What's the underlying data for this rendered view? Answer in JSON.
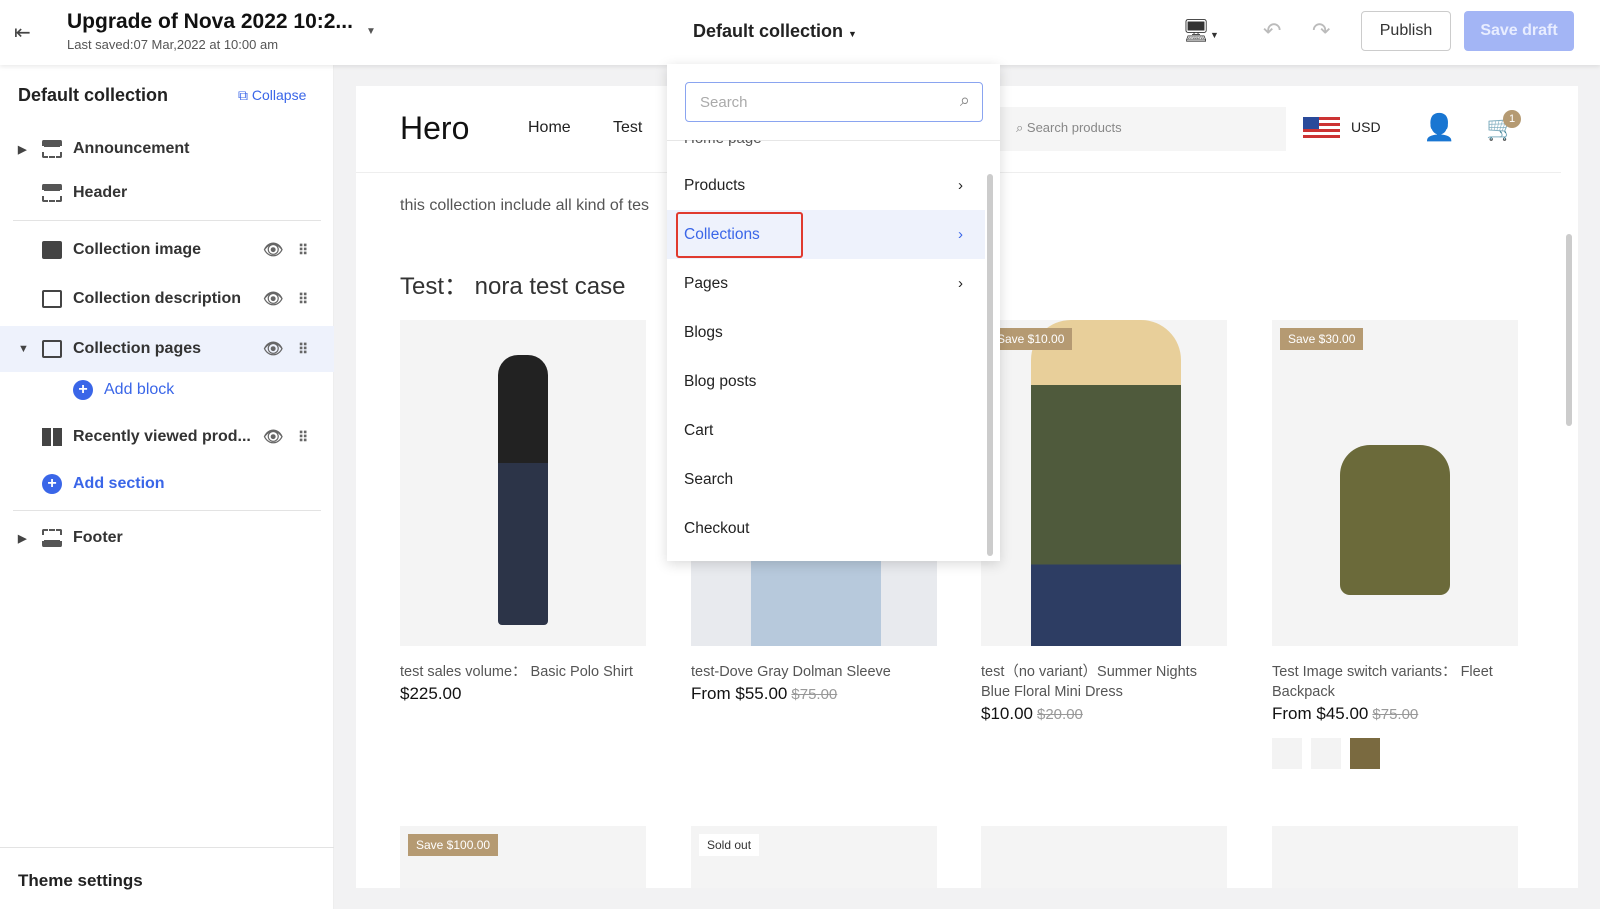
{
  "topbar": {
    "title": "Upgrade of Nova 2022 10:2...",
    "last_saved": "Last saved:07 Mar,2022 at 10:00 am",
    "collection_selector": "Default collection",
    "publish": "Publish",
    "save_draft": "Save draft"
  },
  "sidebar": {
    "title": "Default collection",
    "collapse": "Collapse",
    "items": [
      {
        "label": "Announcement"
      },
      {
        "label": "Header"
      },
      {
        "label": "Collection image"
      },
      {
        "label": "Collection description"
      },
      {
        "label": "Collection pages"
      },
      {
        "label": "Add block"
      },
      {
        "label": "Recently viewed prod..."
      },
      {
        "label": "Add section"
      },
      {
        "label": "Footer"
      }
    ],
    "theme_settings": "Theme settings"
  },
  "store": {
    "logo": "Hero",
    "nav": [
      "Home",
      "Test"
    ],
    "search_placeholder": "Search products",
    "currency": "USD",
    "cart_count": "1",
    "description": "this collection include all kind of tes",
    "heading": "Test： nora test case",
    "products": [
      {
        "name": "test sales volume： Basic Polo Shirt",
        "price": "$225.00",
        "old": ""
      },
      {
        "name": "test-Dove Gray Dolman Sleeve",
        "price": "From $55.00",
        "old": "$75.00"
      },
      {
        "name": "test（no variant）Summer Nights Blue Floral Mini Dress",
        "price": "$10.00",
        "old": "$20.00",
        "badge": "Save $10.00"
      },
      {
        "name": "Test Image switch variants： Fleet Backpack",
        "price": "From $45.00",
        "old": "$75.00",
        "badge": "Save $30.00"
      }
    ],
    "row2_badges": [
      "Save $100.00",
      "Sold out"
    ]
  },
  "dropdown": {
    "search_placeholder": "Search",
    "partial_item": "Home page",
    "items": [
      {
        "label": "Products"
      },
      {
        "label": "Collections"
      },
      {
        "label": "Pages"
      },
      {
        "label": "Blogs"
      },
      {
        "label": "Blog posts"
      },
      {
        "label": "Cart"
      },
      {
        "label": "Search"
      },
      {
        "label": "Checkout"
      }
    ],
    "selected": "Collections"
  },
  "colors": {
    "accent": "#3a66e8",
    "save_draft_bg": "#a3b5f5",
    "highlight_border": "#e03a2f",
    "badge": "#b59a72"
  }
}
